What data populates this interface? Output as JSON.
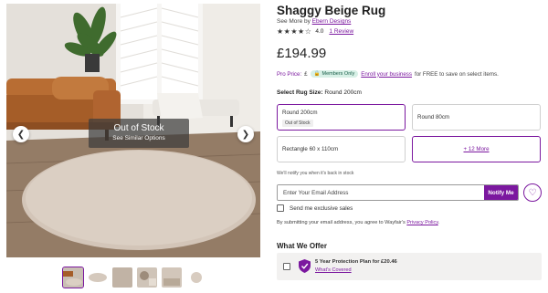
{
  "gallery": {
    "overlay_title": "Out of Stock",
    "overlay_subtitle": "See Similar Options",
    "prev_icon": "chevron-left-icon",
    "next_icon": "chevron-right-icon",
    "prev_glyph": "❮",
    "next_glyph": "❯",
    "thumbnail_count": 6
  },
  "product": {
    "title": "Shaggy Beige Rug",
    "see_more_prefix": "See More by ",
    "brand": "Ebern Designs",
    "rating_value": "4.0",
    "stars": 4,
    "stars_glyph": "★★★★☆",
    "reviews_link": "1 Review",
    "price": "£194.99"
  },
  "pro": {
    "label": "Pro Price:",
    "currency_hint": "£",
    "badge": "Members Only",
    "link": "Enroll your business",
    "suffix": " for FREE to save on select items."
  },
  "size": {
    "label": "Select Rug Size:",
    "selected_value": " Round 200cm",
    "options": [
      {
        "label": "Round 200cm",
        "tag": "Out of Stock",
        "selected": true
      },
      {
        "label": "Round 80cm"
      },
      {
        "label": "Rectangle 60 x 110cm"
      },
      {
        "label": "+ 12 More"
      }
    ]
  },
  "notify": {
    "text": "We'll notify you when it's back in stock",
    "email_placeholder": "Enter Your Email Address",
    "button": "Notify Me",
    "heart_icon": "heart-icon",
    "heart_glyph": "♡",
    "exclusive_label": "Send me exclusive sales"
  },
  "consent": {
    "text": "By submitting your email address, you agree to Wayfair's ",
    "link": "Privacy Policy",
    "end": "."
  },
  "offer": {
    "heading": "What We Offer",
    "plan": "5 Year Protection Plan for £20.46",
    "link": "What's Covered"
  },
  "colors": {
    "accent": "#7b189f",
    "badge_bg": "#d7f0e6"
  }
}
